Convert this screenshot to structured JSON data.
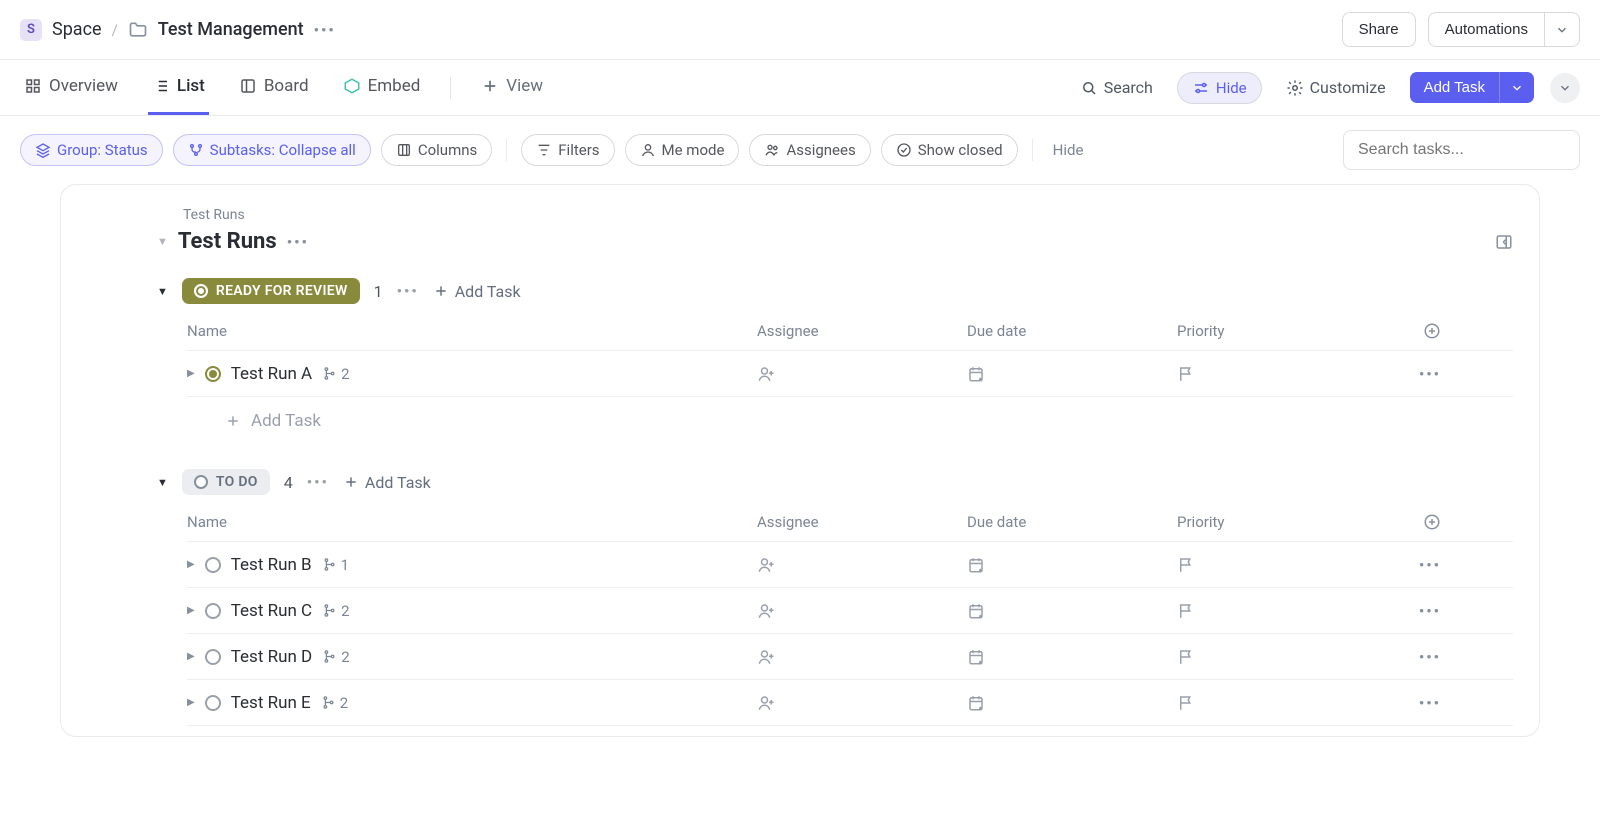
{
  "breadcrumb": {
    "space_badge": "S",
    "space": "Space",
    "folder": "Test Management"
  },
  "header_actions": {
    "share": "Share",
    "automations": "Automations"
  },
  "tabs": {
    "overview": "Overview",
    "list": "List",
    "board": "Board",
    "embed": "Embed",
    "add_view": "View"
  },
  "viewbar": {
    "search": "Search",
    "hide": "Hide",
    "customize": "Customize",
    "add_task": "Add Task"
  },
  "toolbar": {
    "group": "Group: Status",
    "subtasks": "Subtasks: Collapse all",
    "columns": "Columns",
    "filters": "Filters",
    "me_mode": "Me mode",
    "assignees": "Assignees",
    "show_closed": "Show closed",
    "hide": "Hide",
    "search_placeholder": "Search tasks..."
  },
  "section": {
    "path": "Test Runs",
    "title": "Test Runs"
  },
  "columns": {
    "name": "Name",
    "assignee": "Assignee",
    "due": "Due date",
    "priority": "Priority"
  },
  "groups": [
    {
      "status_label": "READY FOR REVIEW",
      "status_kind": "ready",
      "count": "1",
      "add_task": "Add Task",
      "add_task_inline": "Add Task",
      "tasks": [
        {
          "name": "Test Run A",
          "subtasks": "2",
          "status": "ready"
        }
      ]
    },
    {
      "status_label": "TO DO",
      "status_kind": "todo",
      "count": "4",
      "add_task": "Add Task",
      "tasks": [
        {
          "name": "Test Run B",
          "subtasks": "1",
          "status": "todo"
        },
        {
          "name": "Test Run C",
          "subtasks": "2",
          "status": "todo"
        },
        {
          "name": "Test Run D",
          "subtasks": "2",
          "status": "todo"
        },
        {
          "name": "Test Run E",
          "subtasks": "2",
          "status": "todo"
        }
      ]
    }
  ]
}
